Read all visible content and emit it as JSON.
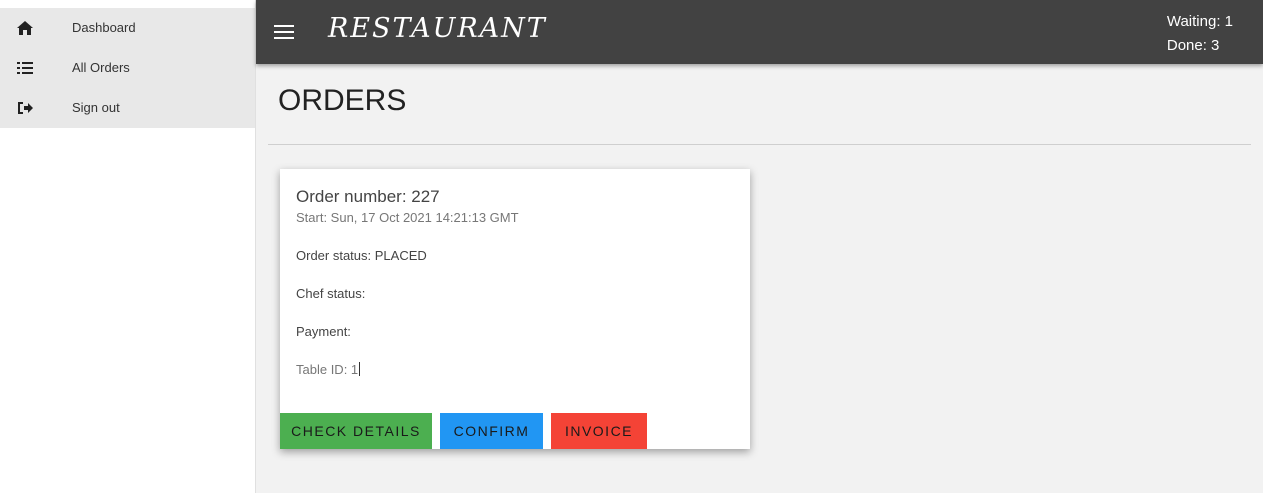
{
  "sidebar": {
    "items": [
      {
        "label": "Dashboard",
        "icon": "home-icon"
      },
      {
        "label": "All Orders",
        "icon": "list-icon"
      },
      {
        "label": "Sign out",
        "icon": "sign-out-icon"
      }
    ]
  },
  "header": {
    "brand": "RESTAURANT",
    "waiting": "Waiting: 1",
    "done": "Done: 3",
    "menu_icon": "hamburger-menu-icon"
  },
  "main": {
    "title": "ORDERS",
    "order": {
      "number": "Order number: 227",
      "start": "Start: Sun, 17 Oct 2021 14:21:13 GMT",
      "order_status": "Order status: PLACED",
      "chef_status": "Chef status:",
      "payment": "Payment:",
      "table_id": "Table ID: 1",
      "buttons": {
        "check_details": "CHECK DETAILS",
        "confirm": "CONFIRM",
        "invoice": "INVOICE"
      }
    }
  },
  "colors": {
    "topbar": "#424242",
    "green": "#4caf50",
    "blue": "#2196f3",
    "red": "#f44336",
    "main_bg": "#f2f2f2"
  }
}
